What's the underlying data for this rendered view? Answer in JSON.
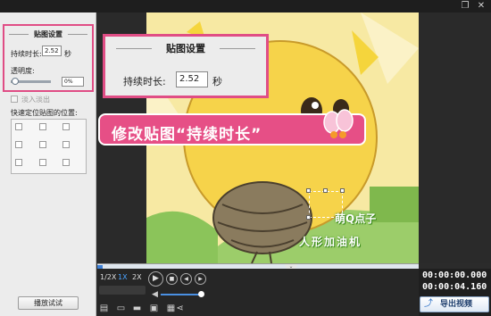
{
  "window": {
    "restore_icon": "restore-icon",
    "close_icon": "close-icon"
  },
  "left_panel": {
    "title": "贴图设置",
    "duration_label": "持续时长:",
    "duration_value": "2.52",
    "duration_unit": "秒",
    "opacity_label": "透明度:",
    "opacity_value": "0%",
    "opacity_level": 0.06,
    "fade_label": "淡入淡出",
    "position_label": "快速定位贴图的位置:",
    "preview_button": "播放试试"
  },
  "callout": {
    "title": "贴图设置",
    "duration_label": "持续时长:",
    "duration_value": "2.52",
    "duration_unit": "秒"
  },
  "banner": {
    "text": "修改贴图“持续时长”",
    "color": "#e64f86"
  },
  "sticker": {
    "line1": "萌Q点子",
    "line2": "人形加油机"
  },
  "playback": {
    "speeds": [
      "1/2X",
      "1X",
      "2X"
    ],
    "active_speed": "1X",
    "current_time": "00:00:00.000",
    "total_time": "00:00:04.160",
    "progress": 0.02,
    "volume": 0.9
  },
  "export": {
    "label": "导出视频",
    "icon": "export-icon"
  },
  "colors": {
    "accent_pink": "#e04d85",
    "accent_blue": "#4aa3ff"
  }
}
